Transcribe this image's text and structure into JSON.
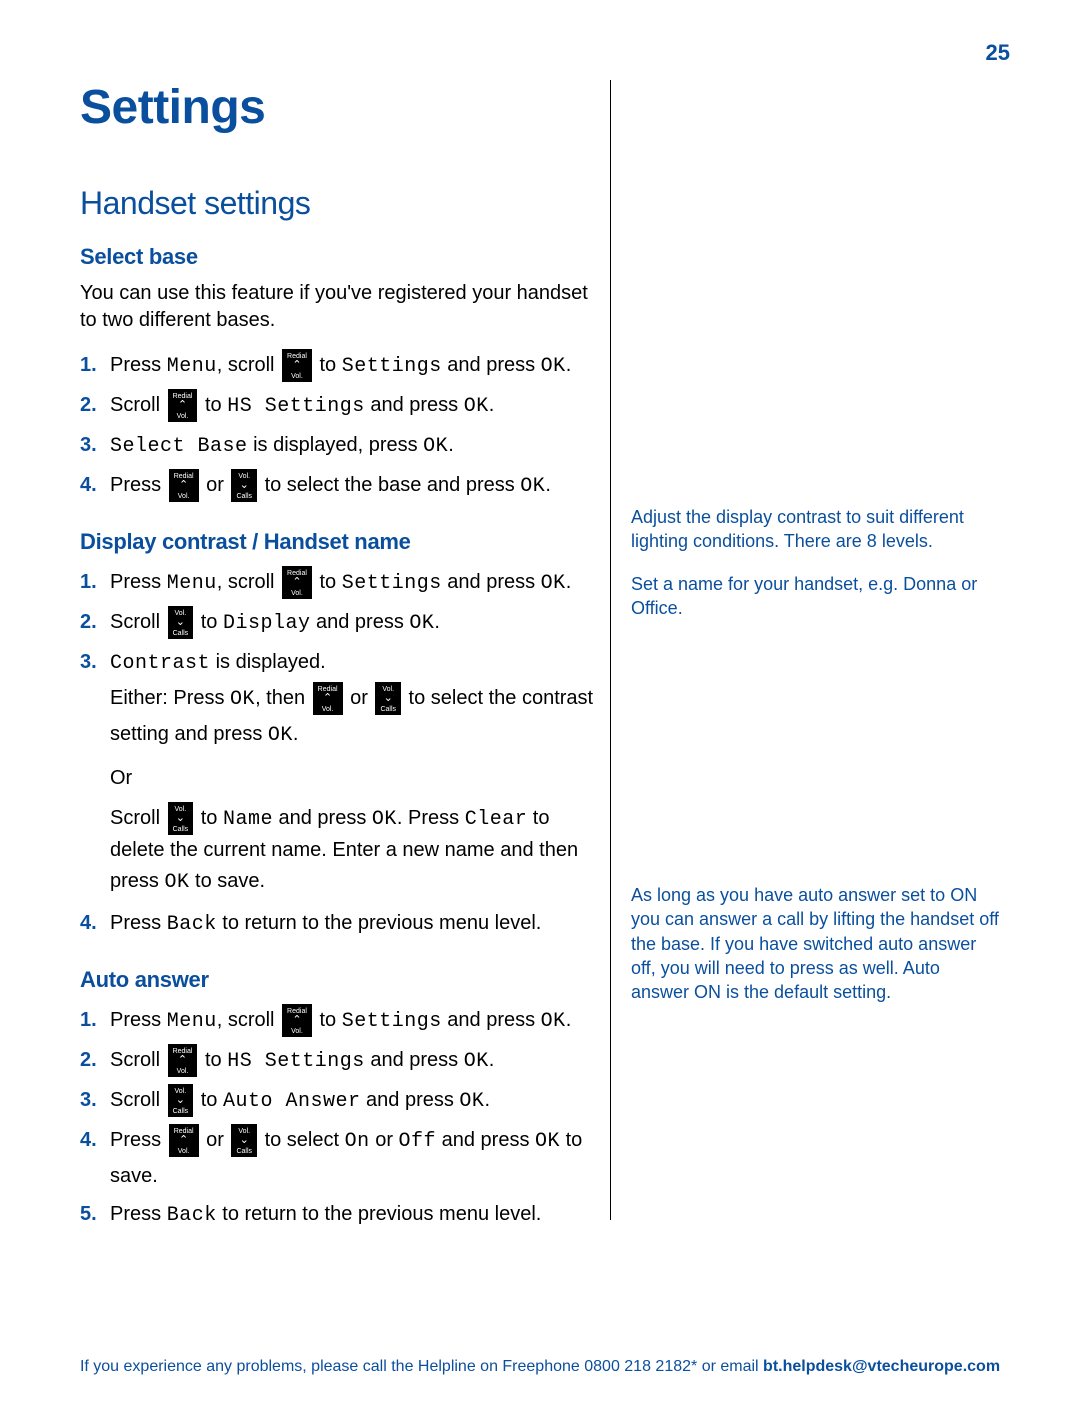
{
  "page_number": "25",
  "title": "Settings",
  "subtitle": "Handset settings",
  "buttons": {
    "up_top": "Redial",
    "up_bot": "Vol.",
    "down_top": "Vol.",
    "down_bot": "Calls"
  },
  "lcd": {
    "menu": "Menu",
    "settings": "Settings",
    "ok": "OK",
    "hs_settings": "HS Settings",
    "select_base": "Select Base",
    "display": "Display",
    "contrast": "Contrast",
    "name": "Name",
    "clear": "Clear",
    "back": "Back",
    "auto_answer": "Auto Answer",
    "on": "On",
    "off": "Off"
  },
  "sections": {
    "select_base": {
      "heading": "Select base",
      "intro": "You can use this feature if you've registered your handset to two different bases.",
      "s1a": "Press ",
      "s1b": ", scroll ",
      "s1c": " to ",
      "s1d": " and press ",
      "s1e": ".",
      "s2a": "Scroll ",
      "s2b": " to ",
      "s2c": " and press ",
      "s2d": ".",
      "s3b": " is displayed, press ",
      "s3c": ".",
      "s4a": "Press ",
      "s4b": " or ",
      "s4c": " to select the base and press ",
      "s4d": "."
    },
    "display_contrast": {
      "heading": "Display contrast / Handset name",
      "s2a": "Scroll ",
      "s2b": " to ",
      "s2c": " and press ",
      "s2d": ".",
      "s3b": " is displayed.",
      "s3c": "Either: Press ",
      "s3d": ", then ",
      "s3e": " or ",
      "s3f": " to select the contrast setting and press ",
      "s3g": ".",
      "or": "Or",
      "s3h": "Scroll ",
      "s3i": " to ",
      "s3j": " and press ",
      "s3k": ". Press ",
      "s3l": " to delete the current name. Enter a new name and then press ",
      "s3m": " to save.",
      "s4a": "Press ",
      "s4b": " to return to the previous menu level."
    },
    "auto_answer": {
      "heading": "Auto answer",
      "s3a": "Scroll ",
      "s3b": " to ",
      "s3c": " and press ",
      "s3d": ".",
      "s4a": "Press ",
      "s4b": " or ",
      "s4c": " to select ",
      "s4d": " or ",
      "s4e": " and press ",
      "s4f": " to save.",
      "s5a": "Press ",
      "s5b": " to return to the previous menu level."
    }
  },
  "sidebar": {
    "note1": "Adjust the display contrast to suit different lighting conditions. There are 8 levels.",
    "note2": "Set a name for your handset, e.g. Donna or Office.",
    "note3": "As long as you have auto answer set to ON you can answer a call by lifting the handset off the base. If you have switched auto answer off, you will need to press as well. Auto answer ON is the default setting."
  },
  "footer": {
    "text": "If you experience any problems, please call the Helpline on Freephone 0800 218 2182* or email ",
    "email": "bt.helpdesk@vtecheurope.com"
  }
}
